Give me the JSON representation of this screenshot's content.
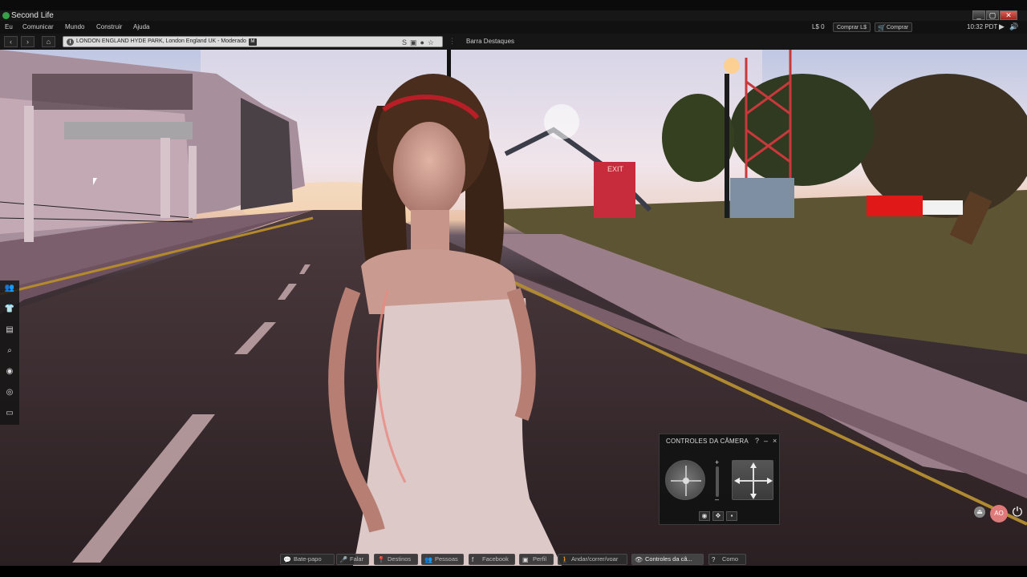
{
  "window": {
    "title": "Second Life",
    "controls": [
      "_",
      "▢",
      "✕"
    ]
  },
  "menu": {
    "items": [
      "Eu",
      "Comunicar",
      "Mundo",
      "Construir",
      "Ajuda"
    ],
    "balance": "L$ 0",
    "buy_ls": "Comprar L$",
    "buy": "Comprar",
    "time": "10:32 PDT"
  },
  "nav": {
    "location": "LONDON ENGLAND HYDE PARK, London England UK - Moderado",
    "maturity_badge": "M",
    "favorites_bar": "Barra Destaques"
  },
  "sidebar": {
    "icons": [
      "people-icon",
      "appearance-icon",
      "inventory-icon",
      "search-icon",
      "places-icon",
      "radar-icon",
      "snapshot-icon"
    ]
  },
  "camera_panel": {
    "title": "CONTROLES DA CÂMERA",
    "help": "?",
    "minimize": "–",
    "close": "×",
    "zoom_in": "+",
    "zoom_out": "–"
  },
  "toolbar": {
    "buttons": [
      {
        "label": "Bate-papo",
        "icon": "chat-icon"
      },
      {
        "label": "Falar",
        "icon": "microphone-icon"
      },
      {
        "label": "Destinos",
        "icon": "destinations-icon"
      },
      {
        "label": "Pessoas",
        "icon": "people-icon"
      },
      {
        "label": "Facebook",
        "icon": "facebook-icon"
      },
      {
        "label": "Perfil",
        "icon": "profile-icon"
      },
      {
        "label": "Andar/correr/voar",
        "icon": "walk-icon"
      },
      {
        "label": "Controles da câ...",
        "icon": "eye-icon"
      },
      {
        "label": "Como",
        "icon": "help-icon"
      }
    ]
  },
  "scene": {
    "exit_sign": "EXIT",
    "avatar_initials": "AO"
  },
  "colors": {
    "accent": "#e07a7a",
    "toolbar_bg": "#2d2d2d",
    "panel_bg": "#121212"
  }
}
